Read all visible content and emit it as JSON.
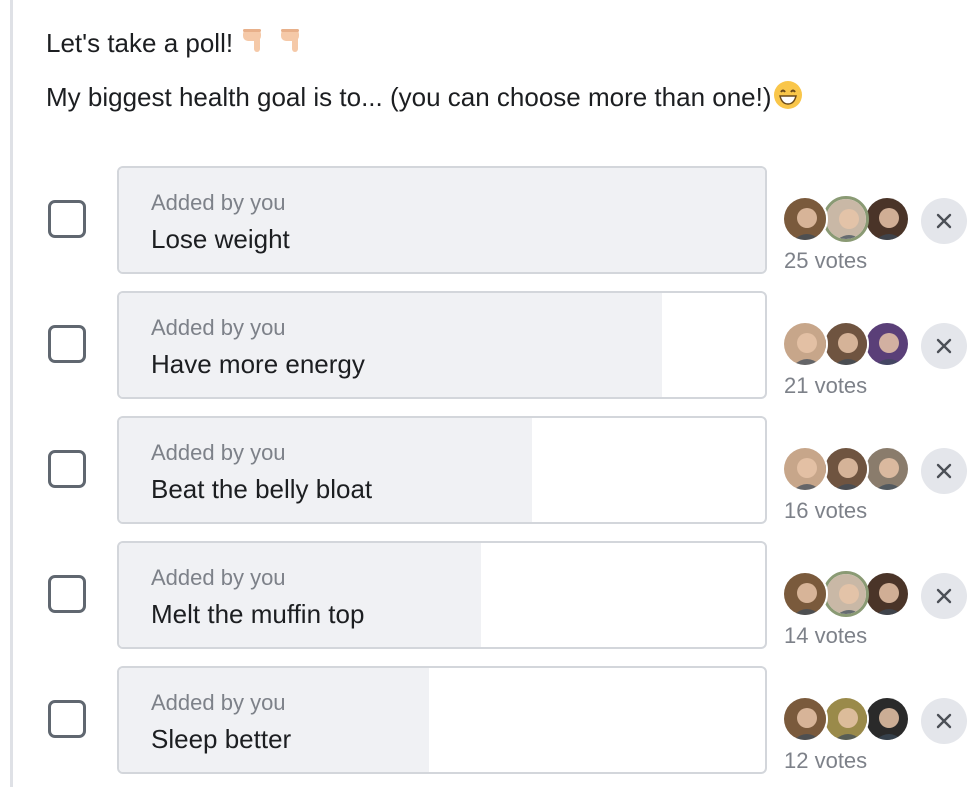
{
  "post": {
    "line1": "Let's take a poll!",
    "line1_icons": [
      "backhand-index-pointing-down-icon",
      "backhand-index-pointing-down-icon"
    ],
    "line2": "My biggest health goal is to... (you can choose more than one!)",
    "line2_icon": "grinning-face-icon"
  },
  "poll": {
    "options": [
      {
        "added_by": "Added by you",
        "label": "Lose weight",
        "votes_text": "25 votes",
        "share": 1.0,
        "voter_colors": [
          "#7a5a3c",
          "#c9b8a6",
          "#4a3428"
        ],
        "voter_ring": 1
      },
      {
        "added_by": "Added by you",
        "label": "Have more energy",
        "votes_text": "21 votes",
        "share": 0.84,
        "voter_colors": [
          "#c7a68a",
          "#6f5440",
          "#5a3f78"
        ],
        "voter_ring": -1
      },
      {
        "added_by": "Added by you",
        "label": "Beat the belly bloat",
        "votes_text": "16 votes",
        "share": 0.64,
        "voter_colors": [
          "#c7a68a",
          "#6f5440",
          "#8a7c6c"
        ],
        "voter_ring": -1
      },
      {
        "added_by": "Added by you",
        "label": "Melt the muffin top",
        "votes_text": "14 votes",
        "share": 0.56,
        "voter_colors": [
          "#7a5a3c",
          "#c9b8a6",
          "#4a3428"
        ],
        "voter_ring": 1
      },
      {
        "added_by": "Added by you",
        "label": "Sleep better",
        "votes_text": "12 votes",
        "share": 0.48,
        "voter_colors": [
          "#7a5a3c",
          "#9a8a4a",
          "#2a2a2a"
        ],
        "voter_ring": -1
      }
    ],
    "remove_icon": "close-icon",
    "checkbox_icon": "checkbox-unchecked-icon"
  },
  "colors": {
    "bar_fill": "#f0f1f4",
    "bar_border": "#d3d6db",
    "muted_text": "#7d8189",
    "remove_bg": "#e4e6eb"
  }
}
